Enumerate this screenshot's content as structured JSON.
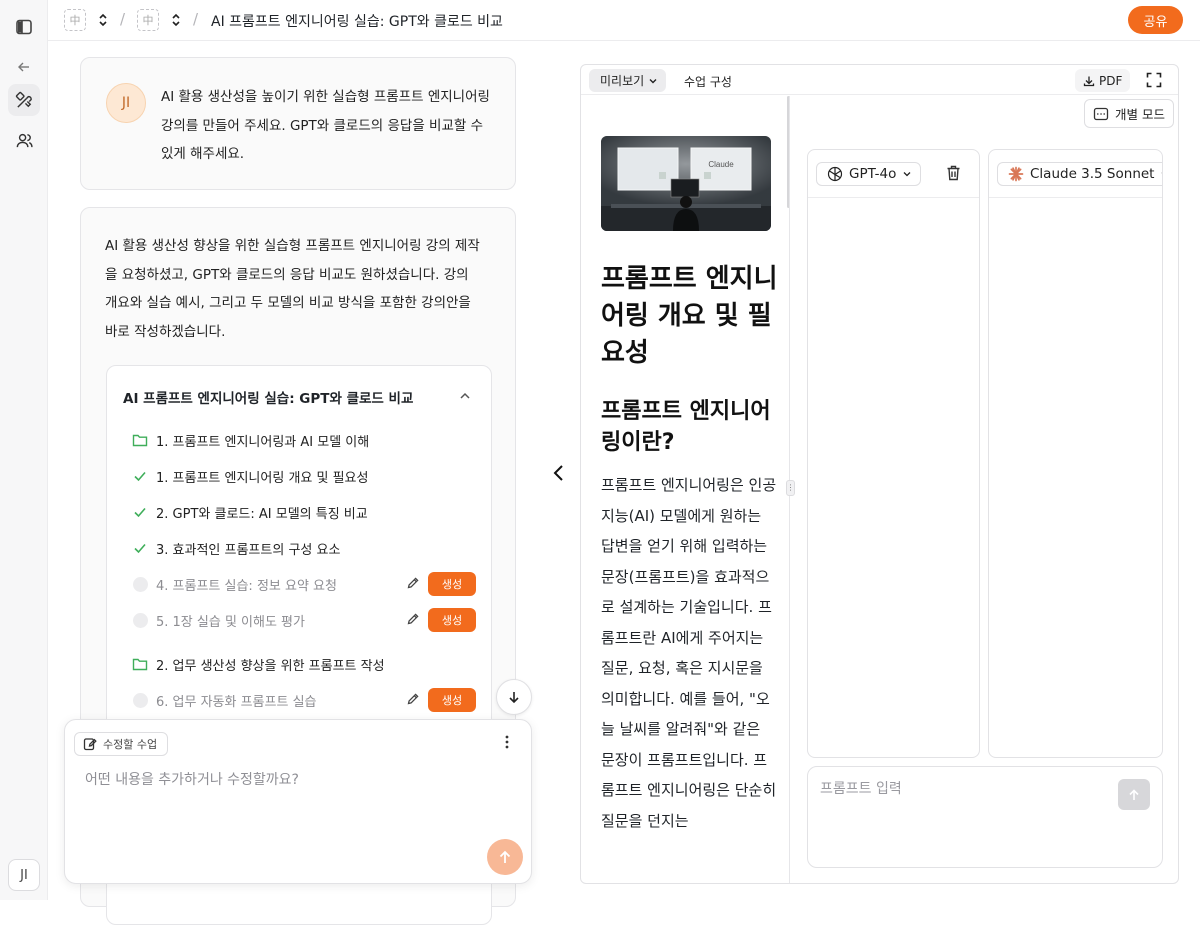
{
  "breadcrumb": {
    "title": "AI 프롬프트 엔지니어링 실습: GPT와 클로드 비교",
    "separator": "/",
    "logo_glyph": "中"
  },
  "header": {
    "share_label": "공유"
  },
  "rail": {
    "avatar_initials": "JI"
  },
  "user_message": {
    "avatar": "JI",
    "text": "AI 활용 생산성을 높이기 위한 실습형 프롬프트 엔지니어링 강의를 만들어 주세요. GPT와 클로드의 응답을 비교할 수 있게 해주세요."
  },
  "ai_message": {
    "text": "AI 활용 생산성 향상을 위한 실습형 프롬프트 엔지니어링 강의 제작을 요청하셨고, GPT와 클로드의 응답 비교도 원하셨습니다. 강의 개요와 실습 예시, 그리고 두 모델의 비교 방식을 포함한 강의안을 바로 작성하겠습니다.",
    "outline": {
      "title": "AI 프롬프트 엔지니어링 실습: GPT와 클로드 비교",
      "items": [
        {
          "type": "folder",
          "label": "1. 프롬프트 엔지니어링과 AI 모델 이해"
        },
        {
          "type": "done",
          "label": "1. 프롬프트 엔지니어링 개요 및 필요성"
        },
        {
          "type": "done",
          "label": "2. GPT와 클로드: AI 모델의 특징 비교"
        },
        {
          "type": "done",
          "label": "3. 효과적인 프롬프트의 구성 요소"
        },
        {
          "type": "pending",
          "label": "4. 프롬프트 실습: 정보 요약 요청",
          "action": "생성"
        },
        {
          "type": "pending",
          "label": "5. 1장 실습 및 이해도 평가",
          "action": "생성"
        },
        {
          "type": "folder",
          "label": "2. 업무 생산성 향상을 위한 프롬프트 작성"
        },
        {
          "type": "pending",
          "label": "6. 업무 자동화 프롬프트 실습",
          "action": "생성"
        }
      ]
    }
  },
  "composer": {
    "context_chip": "수정할 수업",
    "placeholder": "어떤 내용을 추가하거나 수정할까요?"
  },
  "preview": {
    "tab_preview": "미리보기",
    "tab_structure": "수업 구성",
    "pdf_label": "PDF",
    "image_screen_label": "Claude",
    "doc": {
      "h1": "프롬프트 엔지니어링 개요 및 필요성",
      "h2": "프롬프트 엔지니어링이란?",
      "paragraph": "프롬프트 엔지니어링은 인공지능(AI) 모델에게 원하는 답변을 얻기 위해 입력하는 문장(프롬프트)을 효과적으로 설계하는 기술입니다. 프롬프트란 AI에게 주어지는 질문, 요청, 혹은 지시문을 의미합니다. 예를 들어, \"오늘 날씨를 알려줘\"와 같은 문장이 프롬프트입니다. 프롬프트 엔지니어링은 단순히 질문을 던지는"
    },
    "compare": {
      "mode_label": "개별 모드",
      "models": [
        {
          "name": "GPT-4o",
          "icon": "openai-icon"
        },
        {
          "name": "Claude 3.5 Sonnet",
          "icon": "claude-icon"
        }
      ],
      "prompt_placeholder": "프롬프트 입력"
    }
  },
  "colors": {
    "accent": "#f26b1d",
    "check": "#3fae5a",
    "folder": "#3fae5a"
  }
}
